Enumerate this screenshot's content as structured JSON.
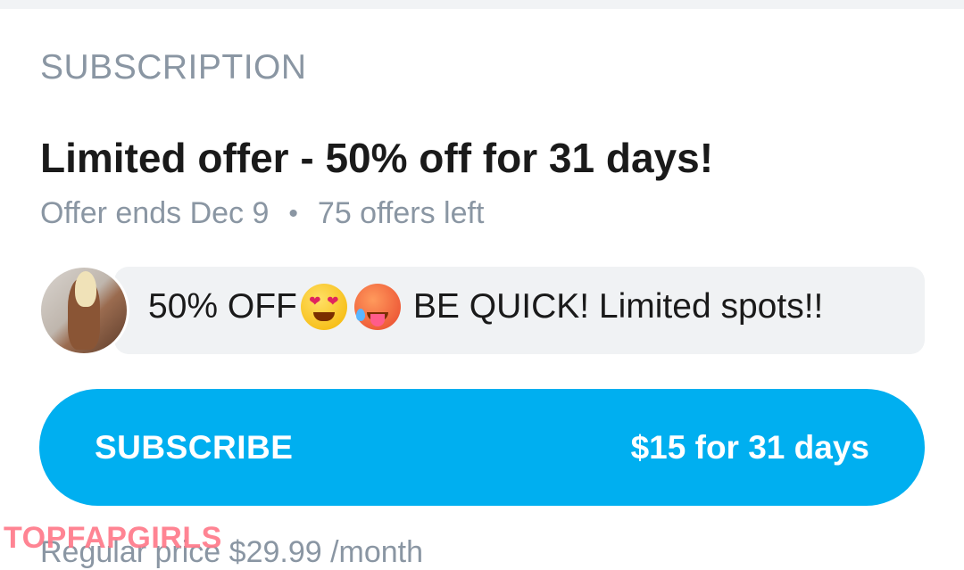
{
  "subscription": {
    "section_title": "SUBSCRIPTION",
    "offer_headline": "Limited offer - 50% off for 31 days!",
    "offer_ends": "Offer ends Dec 9",
    "meta_separator": "•",
    "offers_left": "75 offers left",
    "promo_message": {
      "prefix": "50% OFF",
      "emojis": [
        "heart-eyes-emoji",
        "hot-face-emoji"
      ],
      "suffix": "BE QUICK! Limited spots!!"
    },
    "subscribe_button": {
      "label": "SUBSCRIBE",
      "price": "$15 for 31 days",
      "color": "#00aff0"
    },
    "regular_price": "Regular price $29.99 /month"
  },
  "watermark": "TOPFAPGIRLS"
}
